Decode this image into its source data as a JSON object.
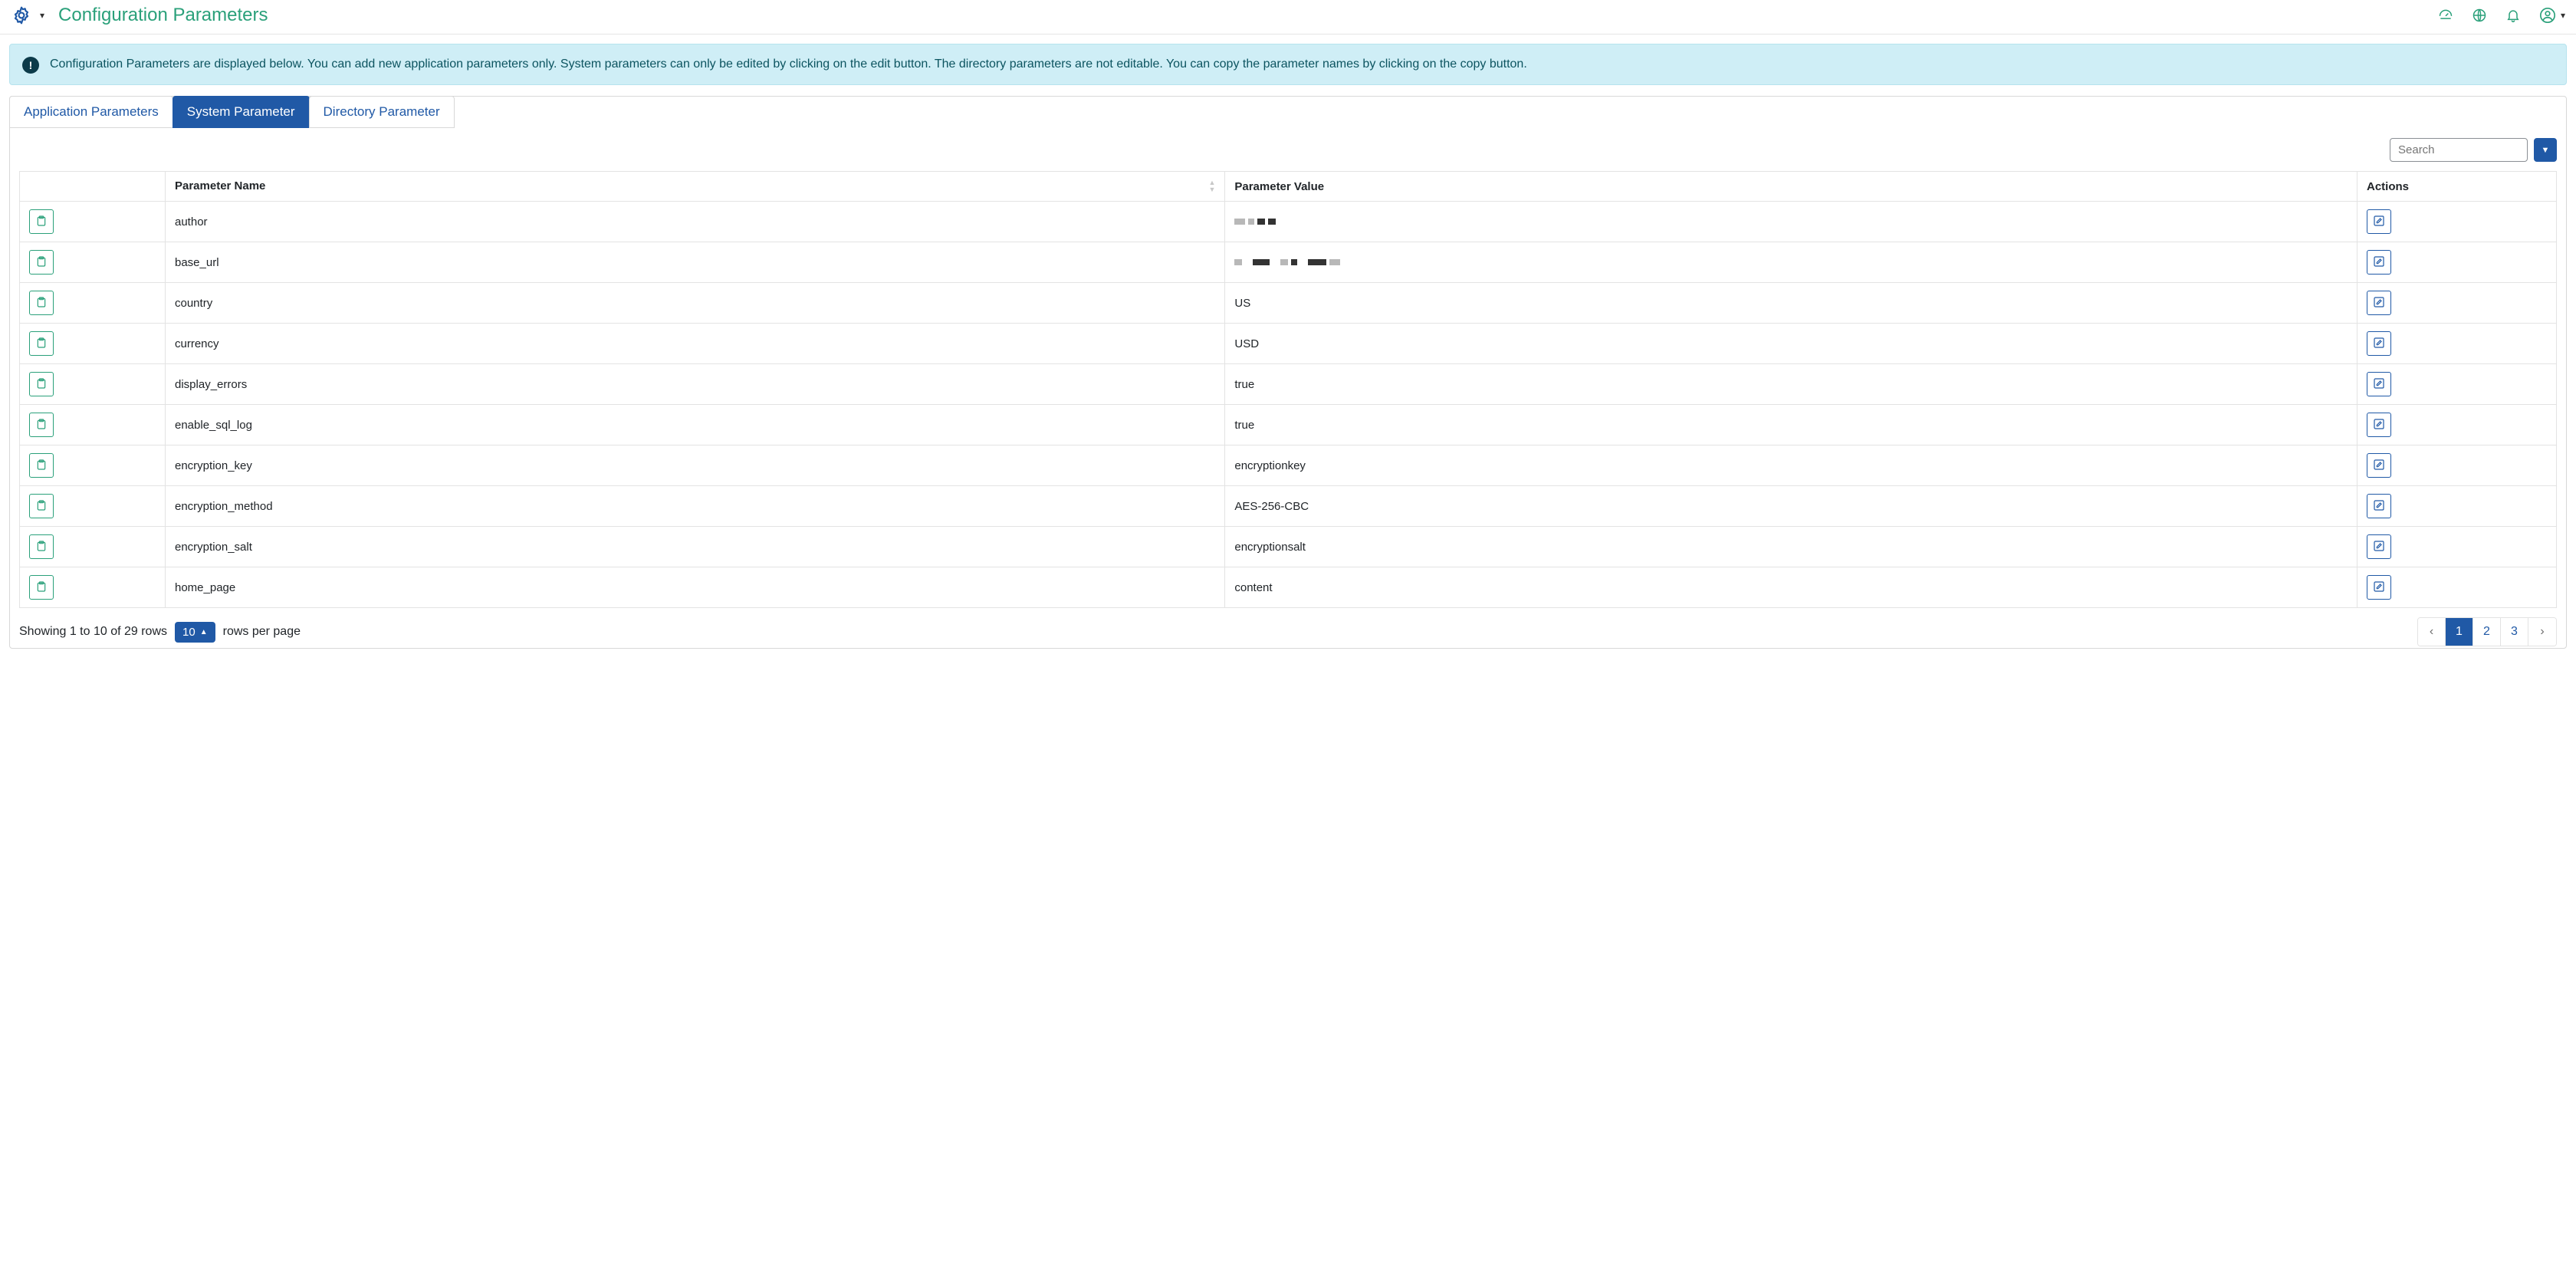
{
  "header": {
    "title": "Configuration Parameters"
  },
  "alert": {
    "text": "Configuration Parameters are displayed below. You can add new application parameters only. System parameters can only be edited by clicking on the edit button. The directory parameters are not editable. You can copy the parameter names by clicking on the copy button."
  },
  "tabs": [
    {
      "id": "app",
      "label": "Application Parameters",
      "active": false
    },
    {
      "id": "sys",
      "label": "System Parameter",
      "active": true
    },
    {
      "id": "dir",
      "label": "Directory Parameter",
      "active": false
    }
  ],
  "search": {
    "placeholder": "Search",
    "value": ""
  },
  "table": {
    "columns": {
      "name": "Parameter Name",
      "value": "Parameter Value",
      "actions": "Actions"
    },
    "rows": [
      {
        "name": "author",
        "value": "",
        "redacted": true
      },
      {
        "name": "base_url",
        "value": "",
        "redacted": true
      },
      {
        "name": "country",
        "value": "US",
        "redacted": false
      },
      {
        "name": "currency",
        "value": "USD",
        "redacted": false
      },
      {
        "name": "display_errors",
        "value": "true",
        "redacted": false
      },
      {
        "name": "enable_sql_log",
        "value": "true",
        "redacted": false
      },
      {
        "name": "encryption_key",
        "value": "encryptionkey",
        "redacted": false
      },
      {
        "name": "encryption_method",
        "value": "AES-256-CBC",
        "redacted": false
      },
      {
        "name": "encryption_salt",
        "value": "encryptionsalt",
        "redacted": false
      },
      {
        "name": "home_page",
        "value": "content",
        "redacted": false
      }
    ]
  },
  "footer": {
    "summary": "Showing 1 to 10 of 29 rows",
    "page_size": "10",
    "rows_per_page_label": "rows per page",
    "pages": [
      {
        "label": "‹",
        "nav": true,
        "active": false
      },
      {
        "label": "1",
        "nav": false,
        "active": true
      },
      {
        "label": "2",
        "nav": false,
        "active": false
      },
      {
        "label": "3",
        "nav": false,
        "active": false
      },
      {
        "label": "›",
        "nav": true,
        "active": false
      }
    ]
  }
}
